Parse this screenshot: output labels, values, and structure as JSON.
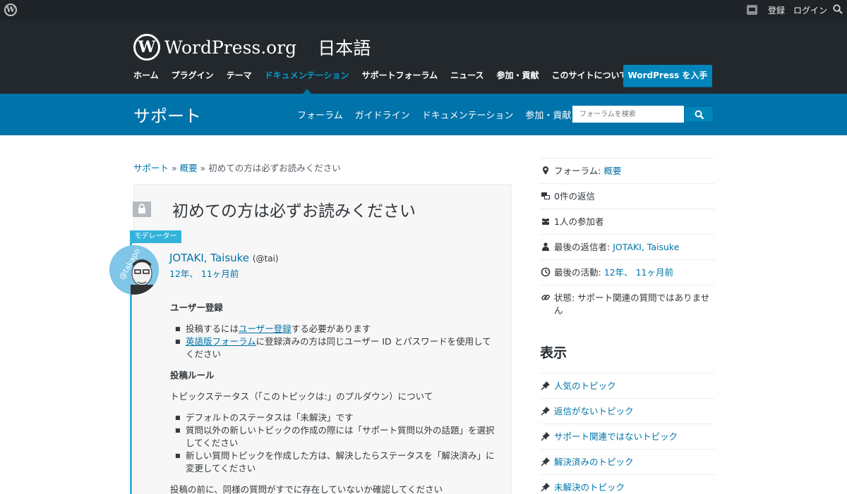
{
  "adminbar": {
    "register": "登録",
    "login": "ログイン"
  },
  "header": {
    "logo_text": "WordPress.org",
    "locale": "日本語",
    "nav": [
      "ホーム",
      "プラグイン",
      "テーマ",
      "ドキュメンテーション",
      "サポートフォーラム",
      "ニュース",
      "参加・貢献",
      "このサイトについて"
    ],
    "active_nav": "ドキュメンテーション",
    "get_wp": "WordPress を入手"
  },
  "support": {
    "title": "サポート",
    "nav": [
      "フォーラム",
      "ガイドライン",
      "ドキュメンテーション",
      "参加・貢献"
    ],
    "search_placeholder": "フォーラムを検索"
  },
  "breadcrumb": {
    "home": "サポート",
    "sep": "»",
    "forum": "概要",
    "current": "初めての方は必ずお読みください"
  },
  "topic": {
    "title": "初めての方は必ずお読みください",
    "role_badge": "モデレーター",
    "author": "JOTAKI, Taisuke",
    "handle": "(@tai)",
    "date": "12年、 11ヶ月前",
    "avatar_text": "@takapo",
    "section1_title": "ユーザー登録",
    "s1_item1_pre": "投稿するには",
    "s1_item1_link": "ユーザー登録",
    "s1_item1_post": "する必要があります",
    "s1_item2_link": "英語版フォーラム",
    "s1_item2_post": "に登録済みの方は同じユーザー ID とパスワードを使用してください",
    "section2_title": "投稿ルール",
    "s2_intro": "トピックステータス（「このトピックは:」のプルダウン）について",
    "s2_items": [
      "デフォルトのステータスは「未解決」です",
      "質問以外の新しいトピックの作成の際には「サポート質問以外の話題」を選択してください",
      "新しい質問トピックを作成した方は、解決したらステータスを「解決済み」に変更してください"
    ],
    "s2_tail": "投稿の前に、同様の質問がすでに存在していないか確認してください"
  },
  "sidebar": {
    "forum_label": "フォーラム:",
    "forum_link": "概要",
    "replies": "0件の返信",
    "participants": "1人の参加者",
    "last_reply_label": "最後の返信者:",
    "last_reply_link": "JOTAKI, Taisuke",
    "last_activity_label": "最後の活動:",
    "last_activity_link": "12年、 11ヶ月前",
    "status": "状態: サポート関連の質問ではありません"
  },
  "views": {
    "title": "表示",
    "items": [
      "人気のトピック",
      "返信がないトピック",
      "サポート関連ではないトピック",
      "解決済みのトピック",
      "未解決のトピック"
    ]
  },
  "colors": {
    "header_bg": "#23282d",
    "support_bg": "#0073aa",
    "link": "#0073aa",
    "accent": "#00a0d2",
    "moderator": "#33b3db"
  }
}
